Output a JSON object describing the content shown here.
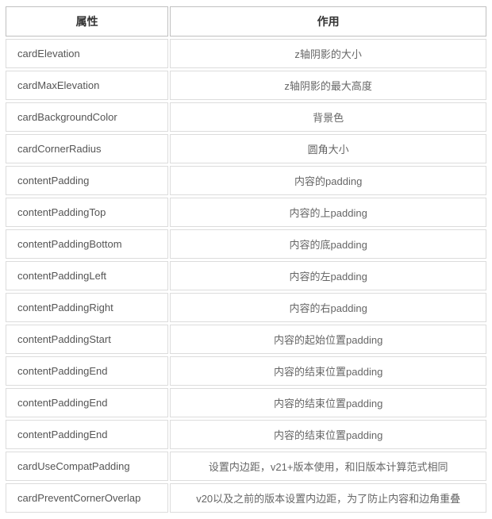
{
  "headers": {
    "attr": "属性",
    "desc": "作用"
  },
  "rows": [
    {
      "attr": "cardElevation",
      "desc": "z轴阴影的大小"
    },
    {
      "attr": "cardMaxElevation",
      "desc": "z轴阴影的最大高度"
    },
    {
      "attr": "cardBackgroundColor",
      "desc": "背景色"
    },
    {
      "attr": "cardCornerRadius",
      "desc": "圆角大小"
    },
    {
      "attr": "contentPadding",
      "desc": "内容的padding"
    },
    {
      "attr": "contentPaddingTop",
      "desc": "内容的上padding"
    },
    {
      "attr": "contentPaddingBottom",
      "desc": "内容的底padding"
    },
    {
      "attr": "contentPaddingLeft",
      "desc": "内容的左padding"
    },
    {
      "attr": "contentPaddingRight",
      "desc": "内容的右padding"
    },
    {
      "attr": "contentPaddingStart",
      "desc": "内容的起始位置padding"
    },
    {
      "attr": "contentPaddingEnd",
      "desc": "内容的结束位置padding"
    },
    {
      "attr": "contentPaddingEnd",
      "desc": "内容的结束位置padding"
    },
    {
      "attr": "contentPaddingEnd",
      "desc": "内容的结束位置padding"
    },
    {
      "attr": "cardUseCompatPadding",
      "desc": "设置内边距，v21+版本使用，和旧版本计算范式相同"
    },
    {
      "attr": "cardPreventCornerOverlap",
      "desc": "v20以及之前的版本设置内边距，为了防止内容和边角重叠"
    }
  ]
}
